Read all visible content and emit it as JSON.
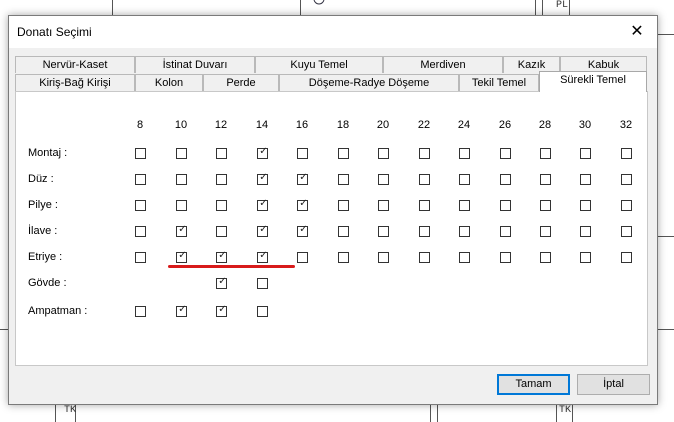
{
  "dialog": {
    "title": "Donatı Seçimi",
    "close_glyph": "✕",
    "tabs_row1": [
      "Nervür-Kaset",
      "İstinat Duvarı",
      "Kuyu Temel",
      "Merdiven",
      "Kazık",
      "Kabuk"
    ],
    "tabs_row2": [
      "Kiriş-Bağ Kirişi",
      "Kolon",
      "Perde",
      "Döşeme-Radye Döşeme",
      "Tekil Temel",
      "Sürekli Temel"
    ],
    "active_tab": "Sürekli Temel",
    "columns": [
      "8",
      "10",
      "12",
      "14",
      "16",
      "18",
      "20",
      "22",
      "24",
      "26",
      "28",
      "30",
      "32"
    ],
    "rows": [
      {
        "label": "Montaj :",
        "checks": [
          false,
          false,
          false,
          true,
          false,
          false,
          false,
          false,
          false,
          false,
          false,
          false,
          false
        ],
        "present": [
          true,
          true,
          true,
          true,
          true,
          true,
          true,
          true,
          true,
          true,
          true,
          true,
          true
        ]
      },
      {
        "label": "Düz :",
        "checks": [
          false,
          false,
          false,
          true,
          true,
          false,
          false,
          false,
          false,
          false,
          false,
          false,
          false
        ],
        "present": [
          true,
          true,
          true,
          true,
          true,
          true,
          true,
          true,
          true,
          true,
          true,
          true,
          true
        ]
      },
      {
        "label": "Pilye :",
        "checks": [
          false,
          false,
          false,
          true,
          true,
          false,
          false,
          false,
          false,
          false,
          false,
          false,
          false
        ],
        "present": [
          true,
          true,
          true,
          true,
          true,
          true,
          true,
          true,
          true,
          true,
          true,
          true,
          true
        ]
      },
      {
        "label": "İlave :",
        "checks": [
          false,
          true,
          false,
          true,
          true,
          false,
          false,
          false,
          false,
          false,
          false,
          false,
          false
        ],
        "present": [
          true,
          true,
          true,
          true,
          true,
          true,
          true,
          true,
          true,
          true,
          true,
          true,
          true
        ]
      },
      {
        "label": "Etriye :",
        "checks": [
          false,
          true,
          true,
          true,
          false,
          false,
          false,
          false,
          false,
          false,
          false,
          false,
          false
        ],
        "present": [
          true,
          true,
          true,
          true,
          true,
          true,
          true,
          true,
          true,
          true,
          true,
          true,
          true
        ]
      },
      {
        "label": "Gövde :",
        "checks": [
          false,
          false,
          true,
          false,
          false,
          false,
          false,
          false,
          false,
          false,
          false,
          false,
          false
        ],
        "present": [
          false,
          false,
          true,
          true,
          false,
          false,
          false,
          false,
          false,
          false,
          false,
          false,
          false
        ]
      },
      {
        "label": "Ampatman :",
        "checks": [
          false,
          true,
          true,
          false,
          false,
          false,
          false,
          false,
          false,
          false,
          false,
          false,
          false
        ],
        "present": [
          true,
          true,
          true,
          true,
          false,
          false,
          false,
          false,
          false,
          false,
          false,
          false,
          false
        ]
      }
    ],
    "check_glyph": "✓",
    "buttons": {
      "ok": "Tamam",
      "cancel": "İptal"
    },
    "colors": {
      "highlight_underline": "#d81b1b",
      "default_button_border": "#0078d7"
    }
  },
  "background": {
    "cad_texts": [
      "TK",
      "TK",
      "PL"
    ]
  }
}
